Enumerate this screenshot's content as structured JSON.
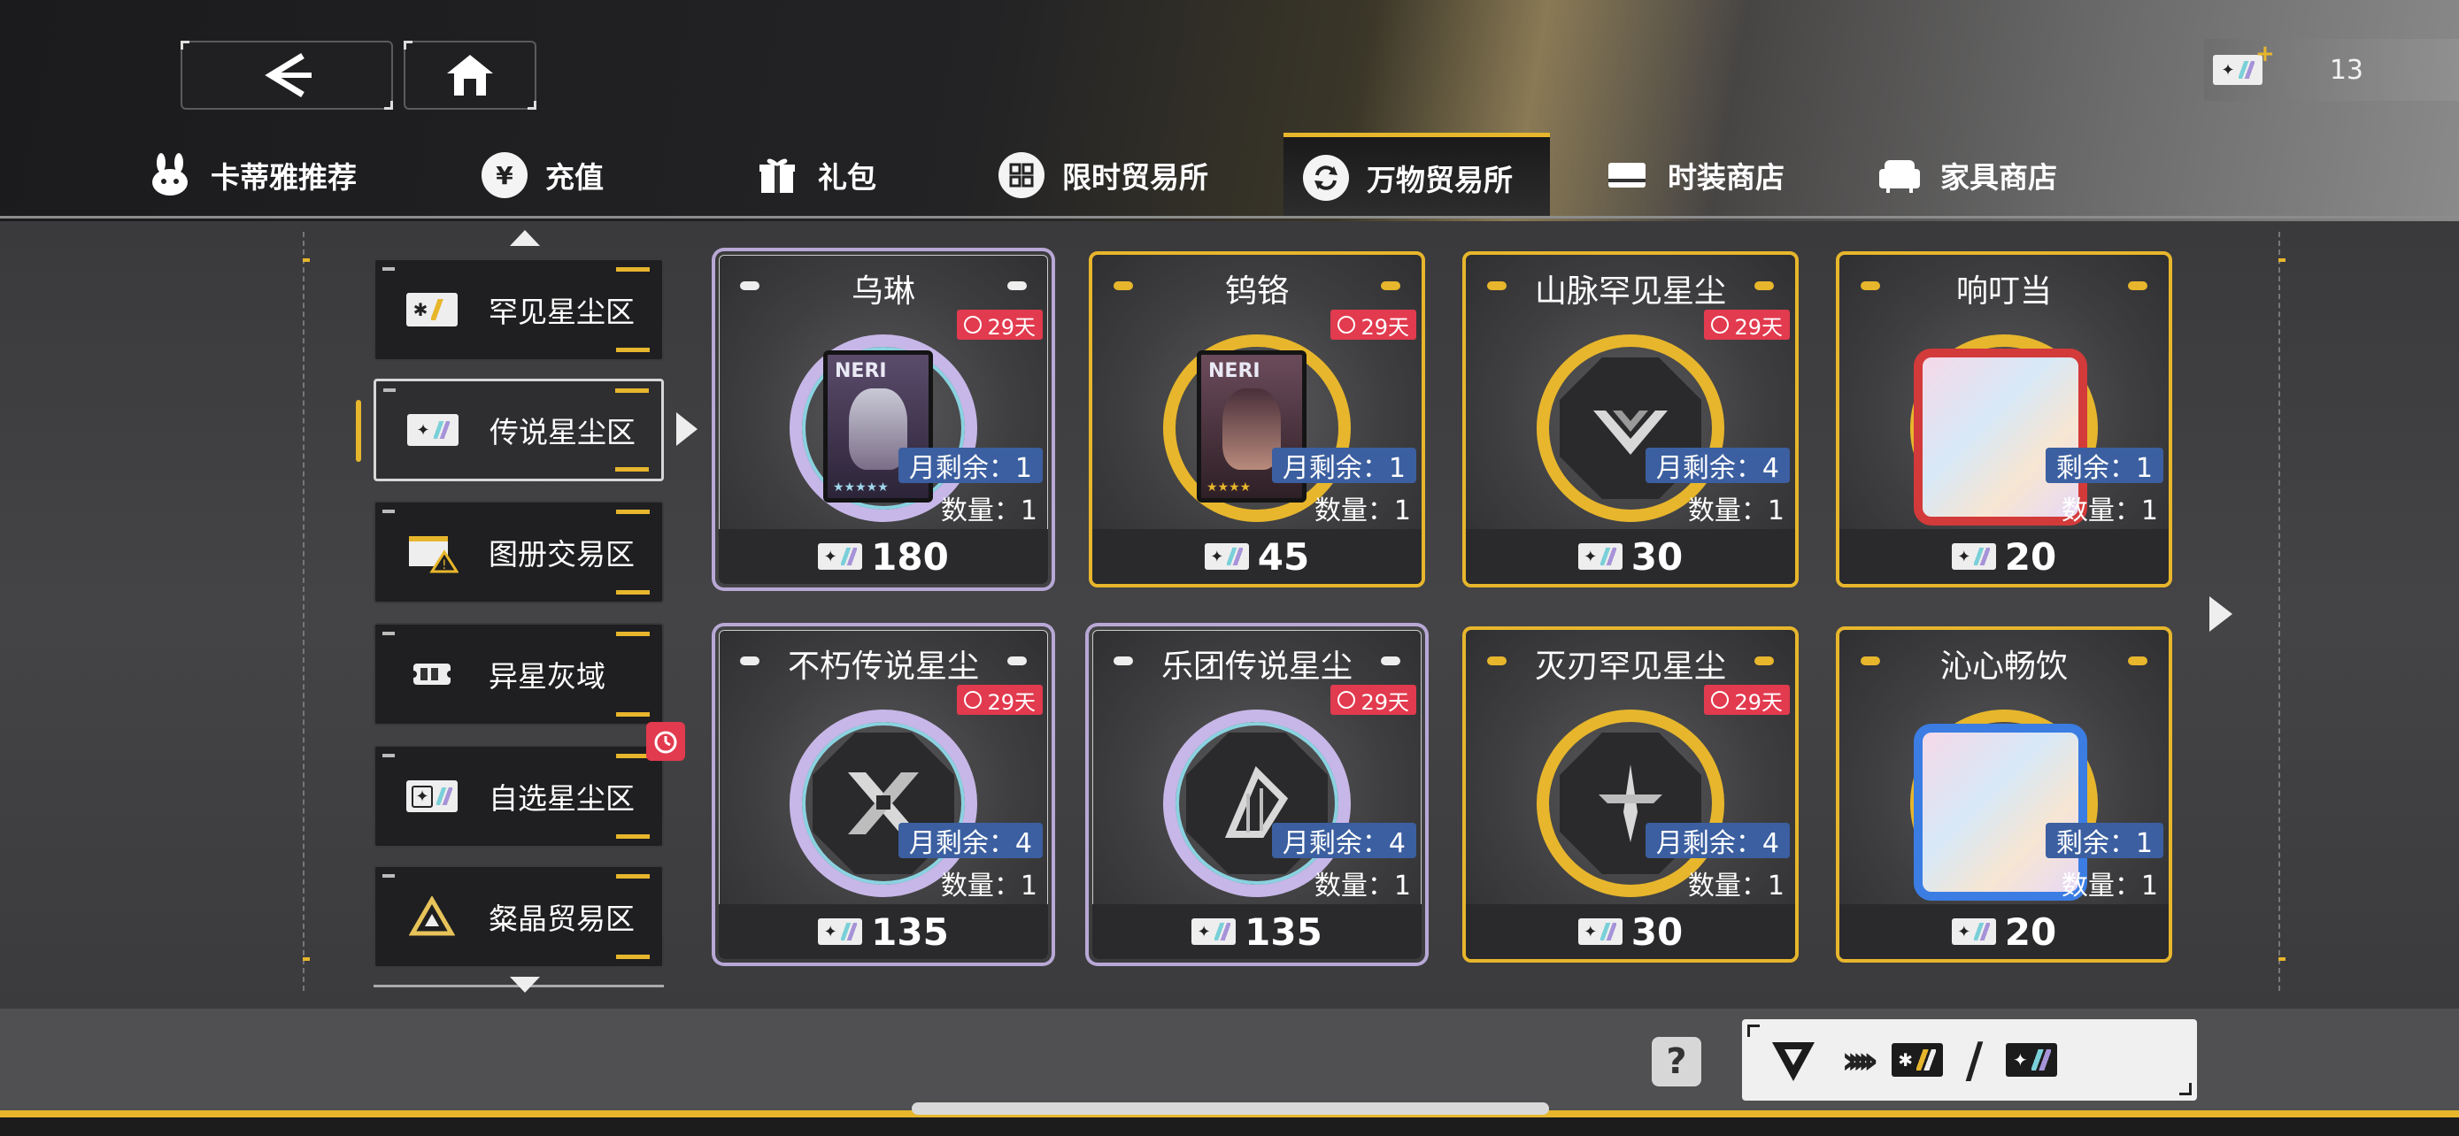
{
  "header": {
    "currency_count": "13"
  },
  "tabs": [
    {
      "label": "卡蒂雅推荐",
      "icon": "bunny-icon"
    },
    {
      "label": "充值",
      "icon": "yen-icon"
    },
    {
      "label": "礼包",
      "icon": "gift-icon"
    },
    {
      "label": "限时贸易所",
      "icon": "grid-icon"
    },
    {
      "label": "万物贸易所",
      "icon": "exchange-icon",
      "active": true
    },
    {
      "label": "时装商店",
      "icon": "card-icon"
    },
    {
      "label": "家具商店",
      "icon": "sofa-icon"
    }
  ],
  "categories": [
    {
      "label": "罕见星尘区",
      "icon": "rare-stardust-icon"
    },
    {
      "label": "传说星尘区",
      "icon": "legend-stardust-icon",
      "active": true
    },
    {
      "label": "图册交易区",
      "icon": "album-icon"
    },
    {
      "label": "异星灰域",
      "icon": "ticket-icon"
    },
    {
      "label": "自选星尘区",
      "icon": "select-stardust-icon"
    },
    {
      "label": "粲晶贸易区",
      "icon": "crystal-icon"
    }
  ],
  "items": [
    {
      "name": "乌琳",
      "days": "29天",
      "remain": "月剩余：1",
      "qty": "数量：1",
      "price": "180",
      "style": "rainbow"
    },
    {
      "name": "钨铬",
      "days": "29天",
      "remain": "月剩余：1",
      "qty": "数量：1",
      "price": "45",
      "style": "gold"
    },
    {
      "name": "山脉罕见星尘",
      "days": "29天",
      "remain": "月剩余：4",
      "qty": "数量：1",
      "price": "30",
      "style": "gold"
    },
    {
      "name": "响叮当",
      "days": "",
      "remain": "剩余：1",
      "qty": "数量：1",
      "price": "20",
      "style": "gold"
    },
    {
      "name": "不朽传说星尘",
      "days": "29天",
      "remain": "月剩余：4",
      "qty": "数量：1",
      "price": "135",
      "style": "rainbow"
    },
    {
      "name": "乐团传说星尘",
      "days": "29天",
      "remain": "月剩余：4",
      "qty": "数量：1",
      "price": "135",
      "style": "rainbow"
    },
    {
      "name": "灭刃罕见星尘",
      "days": "29天",
      "remain": "月剩余：4",
      "qty": "数量：1",
      "price": "30",
      "style": "gold"
    },
    {
      "name": "沁心畅饮",
      "days": "",
      "remain": "剩余：1",
      "qty": "数量：1",
      "price": "20",
      "style": "gold"
    }
  ],
  "portrait_logo": "NERI",
  "help_label": "?",
  "exchange": {
    "chevrons": "›››››",
    "slash": "/"
  },
  "colors": {
    "accent": "#e7b62c",
    "badge_red": "#e23a4e",
    "remain_blue": "#3b5fa0"
  }
}
